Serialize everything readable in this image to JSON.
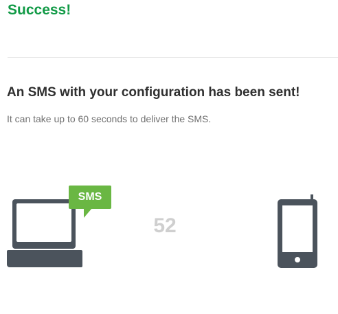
{
  "status": {
    "title": "Success!"
  },
  "message": {
    "headline": "An SMS with your configuration has been sent!",
    "subtext": "It can take up to 60 seconds to deliver the SMS."
  },
  "animation": {
    "bubble_label": "SMS",
    "countdown": "52",
    "icons": [
      "laptop-icon",
      "sms-bubble-icon",
      "phone-icon"
    ]
  },
  "colors": {
    "success_green": "#119a46",
    "bubble_green": "#6ab743",
    "device_gray": "#4b535c",
    "countdown_gray": "#cfcfcf"
  }
}
